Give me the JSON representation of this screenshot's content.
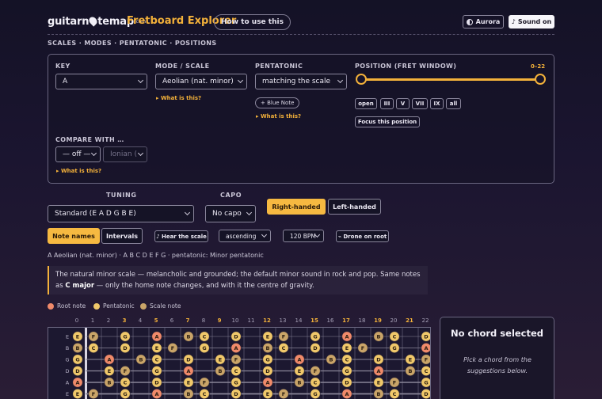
{
  "header": {
    "logo_before": "guitarn",
    "logo_after": "temap",
    "logo_suffix": ".com",
    "title": "Fretboard Explorer",
    "howto": "How to use this",
    "theme": "Aurora",
    "sound": "Sound on"
  },
  "breadcrumb": "SCALES · MODES · PENTATONIC · POSITIONS",
  "controls": {
    "key_label": "KEY",
    "key_value": "A",
    "mode_label": "MODE / SCALE",
    "mode_value": "Aeolian (nat. minor)",
    "mode_help": "▸ What is this?",
    "penta_label": "PENTATONIC",
    "penta_value": "matching the scale",
    "blue_note": "+ Blue Note",
    "penta_help": "▸ What is this?",
    "position_label": "POSITION (FRET WINDOW)",
    "position_range": "0–22",
    "position_buttons": [
      "open",
      "III",
      "V",
      "VII",
      "IX",
      "all"
    ],
    "focus": "Focus this position",
    "compare_label": "COMPARE WITH …",
    "compare_value": "— off —",
    "compare_mode": "Ionian (",
    "compare_help": "▸ What is this?"
  },
  "tuning": {
    "label": "TUNING",
    "value": "Standard (E A D G B E)",
    "capo_label": "CAPO",
    "capo_value": "No capo",
    "right": "Right-handed",
    "left": "Left-handed"
  },
  "display": {
    "note_names": "Note names",
    "intervals": "Intervals",
    "hear": "♪ Hear the scale",
    "direction": "ascending",
    "tempo": "120 BPM",
    "drone": "⌁ Drone on root"
  },
  "summary": "A Aeolian (nat. minor) · A B C D E F G · pentatonic: Minor pentatonic",
  "note": {
    "before": "The natural minor scale — melancholic and grounded; the default minor sound in rock and pop. Same notes as ",
    "bold": "C major",
    "after": " — only the home note changes, and with it the centre of gravity."
  },
  "legend": {
    "root": "Root note",
    "penta": "Pentatonic",
    "scale": "Scale note"
  },
  "colors": {
    "root": "#f08a6a",
    "penta": "#f0c86a",
    "scale": "#c9a468",
    "accent": "#f3b13a"
  },
  "fret_numbers": [
    "0",
    "1",
    "2",
    "3",
    "4",
    "5",
    "6",
    "7",
    "8",
    "9",
    "10",
    "11",
    "12",
    "13",
    "14",
    "15",
    "16",
    "17",
    "18",
    "19",
    "20",
    "21",
    "22"
  ],
  "string_labels": [
    "E",
    "B",
    "G",
    "D",
    "A",
    "E"
  ],
  "chord": {
    "title": "No chord selected",
    "subtitle": "Pick a chord from the suggestions below."
  }
}
